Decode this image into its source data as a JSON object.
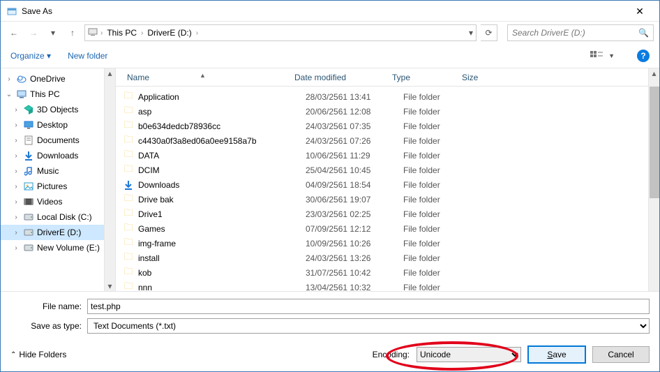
{
  "window": {
    "title": "Save As"
  },
  "nav": {
    "crumb1": "This PC",
    "crumb2": "DriverE (D:)",
    "search_placeholder": "Search DriverE (D:)"
  },
  "toolbar": {
    "organize": "Organize ▾",
    "newfolder": "New folder"
  },
  "tree": {
    "items": [
      {
        "label": "OneDrive",
        "indent": 1,
        "icon": "cloud"
      },
      {
        "label": "This PC",
        "indent": 1,
        "icon": "pc",
        "expanded": true
      },
      {
        "label": "3D Objects",
        "indent": 2,
        "icon": "3d"
      },
      {
        "label": "Desktop",
        "indent": 2,
        "icon": "desktop"
      },
      {
        "label": "Documents",
        "indent": 2,
        "icon": "docs"
      },
      {
        "label": "Downloads",
        "indent": 2,
        "icon": "dl"
      },
      {
        "label": "Music",
        "indent": 2,
        "icon": "music"
      },
      {
        "label": "Pictures",
        "indent": 2,
        "icon": "pics"
      },
      {
        "label": "Videos",
        "indent": 2,
        "icon": "vids"
      },
      {
        "label": "Local Disk (C:)",
        "indent": 2,
        "icon": "drive"
      },
      {
        "label": "DriverE (D:)",
        "indent": 2,
        "icon": "drive",
        "selected": true
      },
      {
        "label": "New Volume (E:)",
        "indent": 2,
        "icon": "drive"
      }
    ]
  },
  "columns": {
    "name": "Name",
    "date": "Date modified",
    "type": "Type",
    "size": "Size"
  },
  "files": [
    {
      "name": "Application",
      "date": "28/03/2561 13:41",
      "type": "File folder",
      "icon": "folder"
    },
    {
      "name": "asp",
      "date": "20/06/2561 12:08",
      "type": "File folder",
      "icon": "folder"
    },
    {
      "name": "b0e634dedcb78936cc",
      "date": "24/03/2561 07:35",
      "type": "File folder",
      "icon": "folder"
    },
    {
      "name": "c4430a0f3a8ed06a0ee9158a7b",
      "date": "24/03/2561 07:26",
      "type": "File folder",
      "icon": "folder"
    },
    {
      "name": "DATA",
      "date": "10/06/2561 11:29",
      "type": "File folder",
      "icon": "folder"
    },
    {
      "name": "DCIM",
      "date": "25/04/2561 10:45",
      "type": "File folder",
      "icon": "folder"
    },
    {
      "name": "Downloads",
      "date": "04/09/2561 18:54",
      "type": "File folder",
      "icon": "dl"
    },
    {
      "name": "Drive bak",
      "date": "30/06/2561 19:07",
      "type": "File folder",
      "icon": "folder"
    },
    {
      "name": "Drive1",
      "date": "23/03/2561 02:25",
      "type": "File folder",
      "icon": "folder"
    },
    {
      "name": "Games",
      "date": "07/09/2561 12:12",
      "type": "File folder",
      "icon": "folder"
    },
    {
      "name": "img-frame",
      "date": "10/09/2561 10:26",
      "type": "File folder",
      "icon": "folder"
    },
    {
      "name": "install",
      "date": "24/03/2561 13:26",
      "type": "File folder",
      "icon": "folder"
    },
    {
      "name": "kob",
      "date": "31/07/2561 10:42",
      "type": "File folder",
      "icon": "folder"
    },
    {
      "name": "nnn",
      "date": "13/04/2561 10:32",
      "type": "File folder",
      "icon": "folder"
    }
  ],
  "form": {
    "filename_label": "File name:",
    "filename_value": "test.php",
    "type_label": "Save as type:",
    "type_value": "Text Documents (*.txt)"
  },
  "footer": {
    "hide": "Hide Folders",
    "encoding_label": "Encoding:",
    "encoding_value": "Unicode",
    "save": "Save",
    "cancel": "Cancel"
  }
}
